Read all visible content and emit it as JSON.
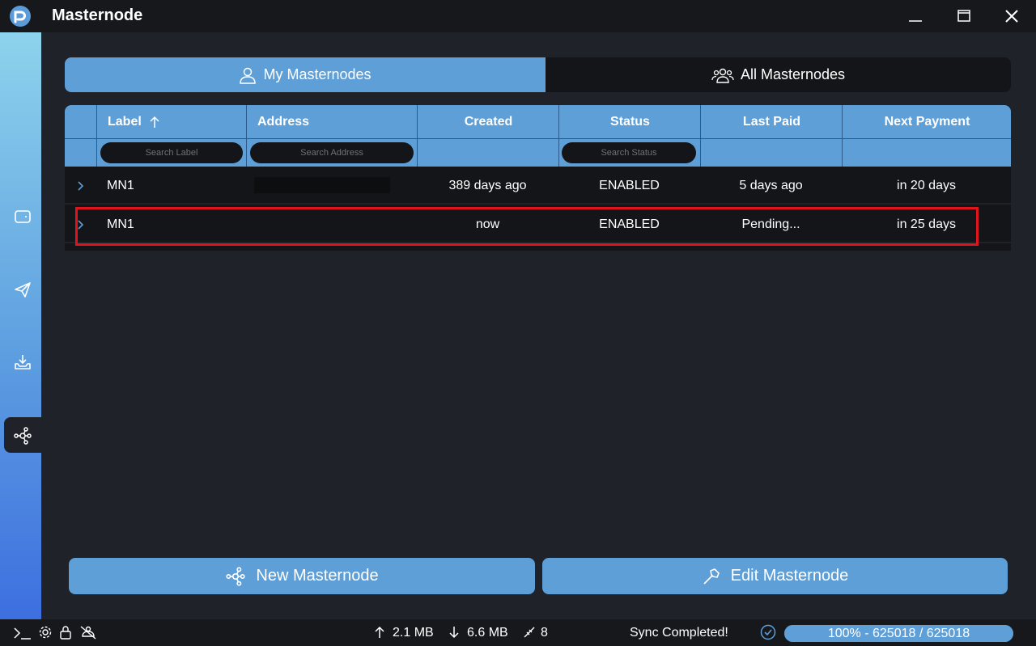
{
  "app": {
    "title": "Masternode",
    "logo_icon": "p-logo-icon"
  },
  "window_controls": [
    "minimize-icon",
    "maximize-icon",
    "close-icon"
  ],
  "sidebar": {
    "items": [
      {
        "name": "wallet",
        "icon": "wallet-icon",
        "active": false
      },
      {
        "name": "send",
        "icon": "send-icon",
        "active": false
      },
      {
        "name": "receive",
        "icon": "receive-icon",
        "active": false
      },
      {
        "name": "masternodes",
        "icon": "network-icon",
        "active": true
      }
    ]
  },
  "tabs": [
    {
      "label": "My Masternodes",
      "icon": "user-icon",
      "active": true
    },
    {
      "label": "All Masternodes",
      "icon": "users-icon",
      "active": false
    }
  ],
  "table": {
    "columns": [
      {
        "label": "Label",
        "sort": "ascending"
      },
      {
        "label": "Address"
      },
      {
        "label": "Created"
      },
      {
        "label": "Status"
      },
      {
        "label": "Last Paid"
      },
      {
        "label": "Next Payment"
      }
    ],
    "filters": {
      "label_placeholder": "Search Label",
      "address_placeholder": "Search Address",
      "status_placeholder": "Search Status"
    },
    "rows": [
      {
        "label": "MN1",
        "address": "",
        "created": "389 days ago",
        "status": "ENABLED",
        "last_paid": "5 days ago",
        "next_payment": "in 20 days"
      },
      {
        "label": "MN1",
        "address": "",
        "created": "now",
        "status": "ENABLED",
        "last_paid": "Pending...",
        "next_payment": "in 25 days"
      }
    ]
  },
  "buttons": {
    "new_masternode": "New Masternode",
    "edit_masternode": "Edit Masternode"
  },
  "statusbar": {
    "upload": "2.1 MB",
    "download": "6.6 MB",
    "peers": "8",
    "sync_text": "Sync Completed!",
    "progress_text": "100% - 625018 / 625018",
    "progress_percent": 100
  },
  "colors": {
    "accent": "#5e9fd8",
    "background": "#1f2228",
    "highlight": "#e0141c"
  }
}
